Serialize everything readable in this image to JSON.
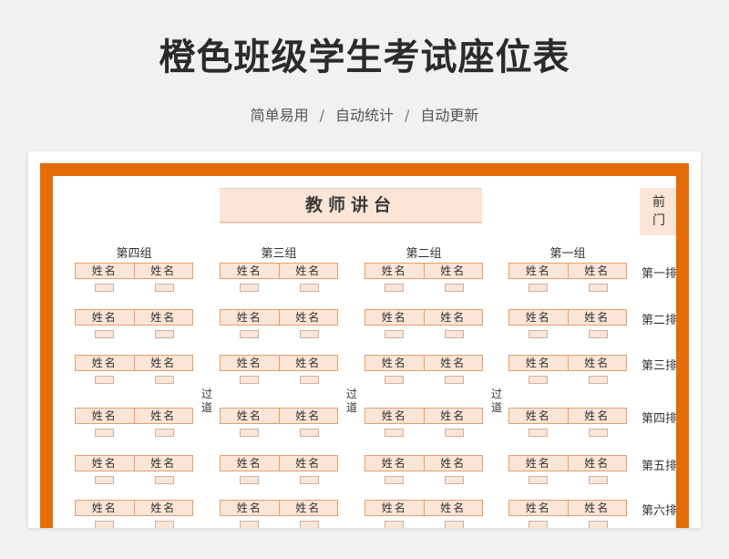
{
  "header": {
    "title": "橙色班级学生考试座位表",
    "subtitle_items": [
      "简单易用",
      "自动统计",
      "自动更新"
    ],
    "separator": "/"
  },
  "sheet": {
    "podium": "教师讲台",
    "front_door": [
      "前",
      "门"
    ],
    "aisle": [
      "过",
      "道"
    ],
    "groups": [
      "第四组",
      "第三组",
      "第二组",
      "第一组"
    ],
    "seat_label": "姓名",
    "rows": [
      "第一排",
      "第二排",
      "第三排",
      "第四排",
      "第五排",
      "第六排"
    ]
  },
  "colors": {
    "frame_orange": "#e46c0a",
    "seat_fill": "#fbe5d6",
    "seat_border": "#e2a070",
    "background": "#f1f1f3"
  }
}
